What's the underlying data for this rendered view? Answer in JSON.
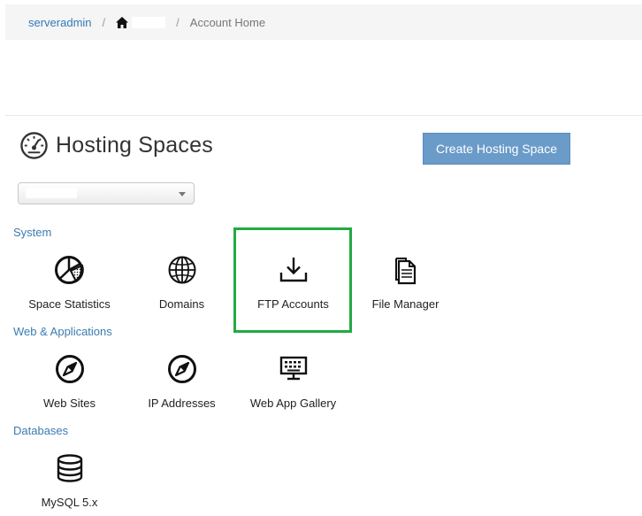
{
  "breadcrumb": {
    "user": "serveradmin",
    "separator": "/",
    "current": "Account Home",
    "home_icon": "home-icon"
  },
  "header": {
    "title": "Hosting Spaces",
    "title_icon": "gauge-icon",
    "create_button": "Create Hosting Space"
  },
  "space_select": {
    "value": ""
  },
  "sections": {
    "system": "System",
    "web": "Web & Applications",
    "databases": "Databases"
  },
  "tiles": {
    "space_statistics": {
      "label": "Space Statistics",
      "icon": "pie-chart-icon"
    },
    "domains": {
      "label": "Domains",
      "icon": "globe-icon"
    },
    "ftp_accounts": {
      "label": "FTP Accounts",
      "icon": "download-icon"
    },
    "file_manager": {
      "label": "File Manager",
      "icon": "file-copy-icon"
    },
    "web_sites": {
      "label": "Web Sites",
      "icon": "compass-icon"
    },
    "ip_addresses": {
      "label": "IP Addresses",
      "icon": "compass-icon"
    },
    "web_app_gallery": {
      "label": "Web App Gallery",
      "icon": "monitor-keyboard-icon"
    },
    "mysql": {
      "label": "MySQL 5.x",
      "icon": "database-icon"
    }
  },
  "colors": {
    "link": "#337ab7",
    "button": "#6a9bc9",
    "section": "#3c7bb0",
    "highlight": "#22aa44"
  }
}
